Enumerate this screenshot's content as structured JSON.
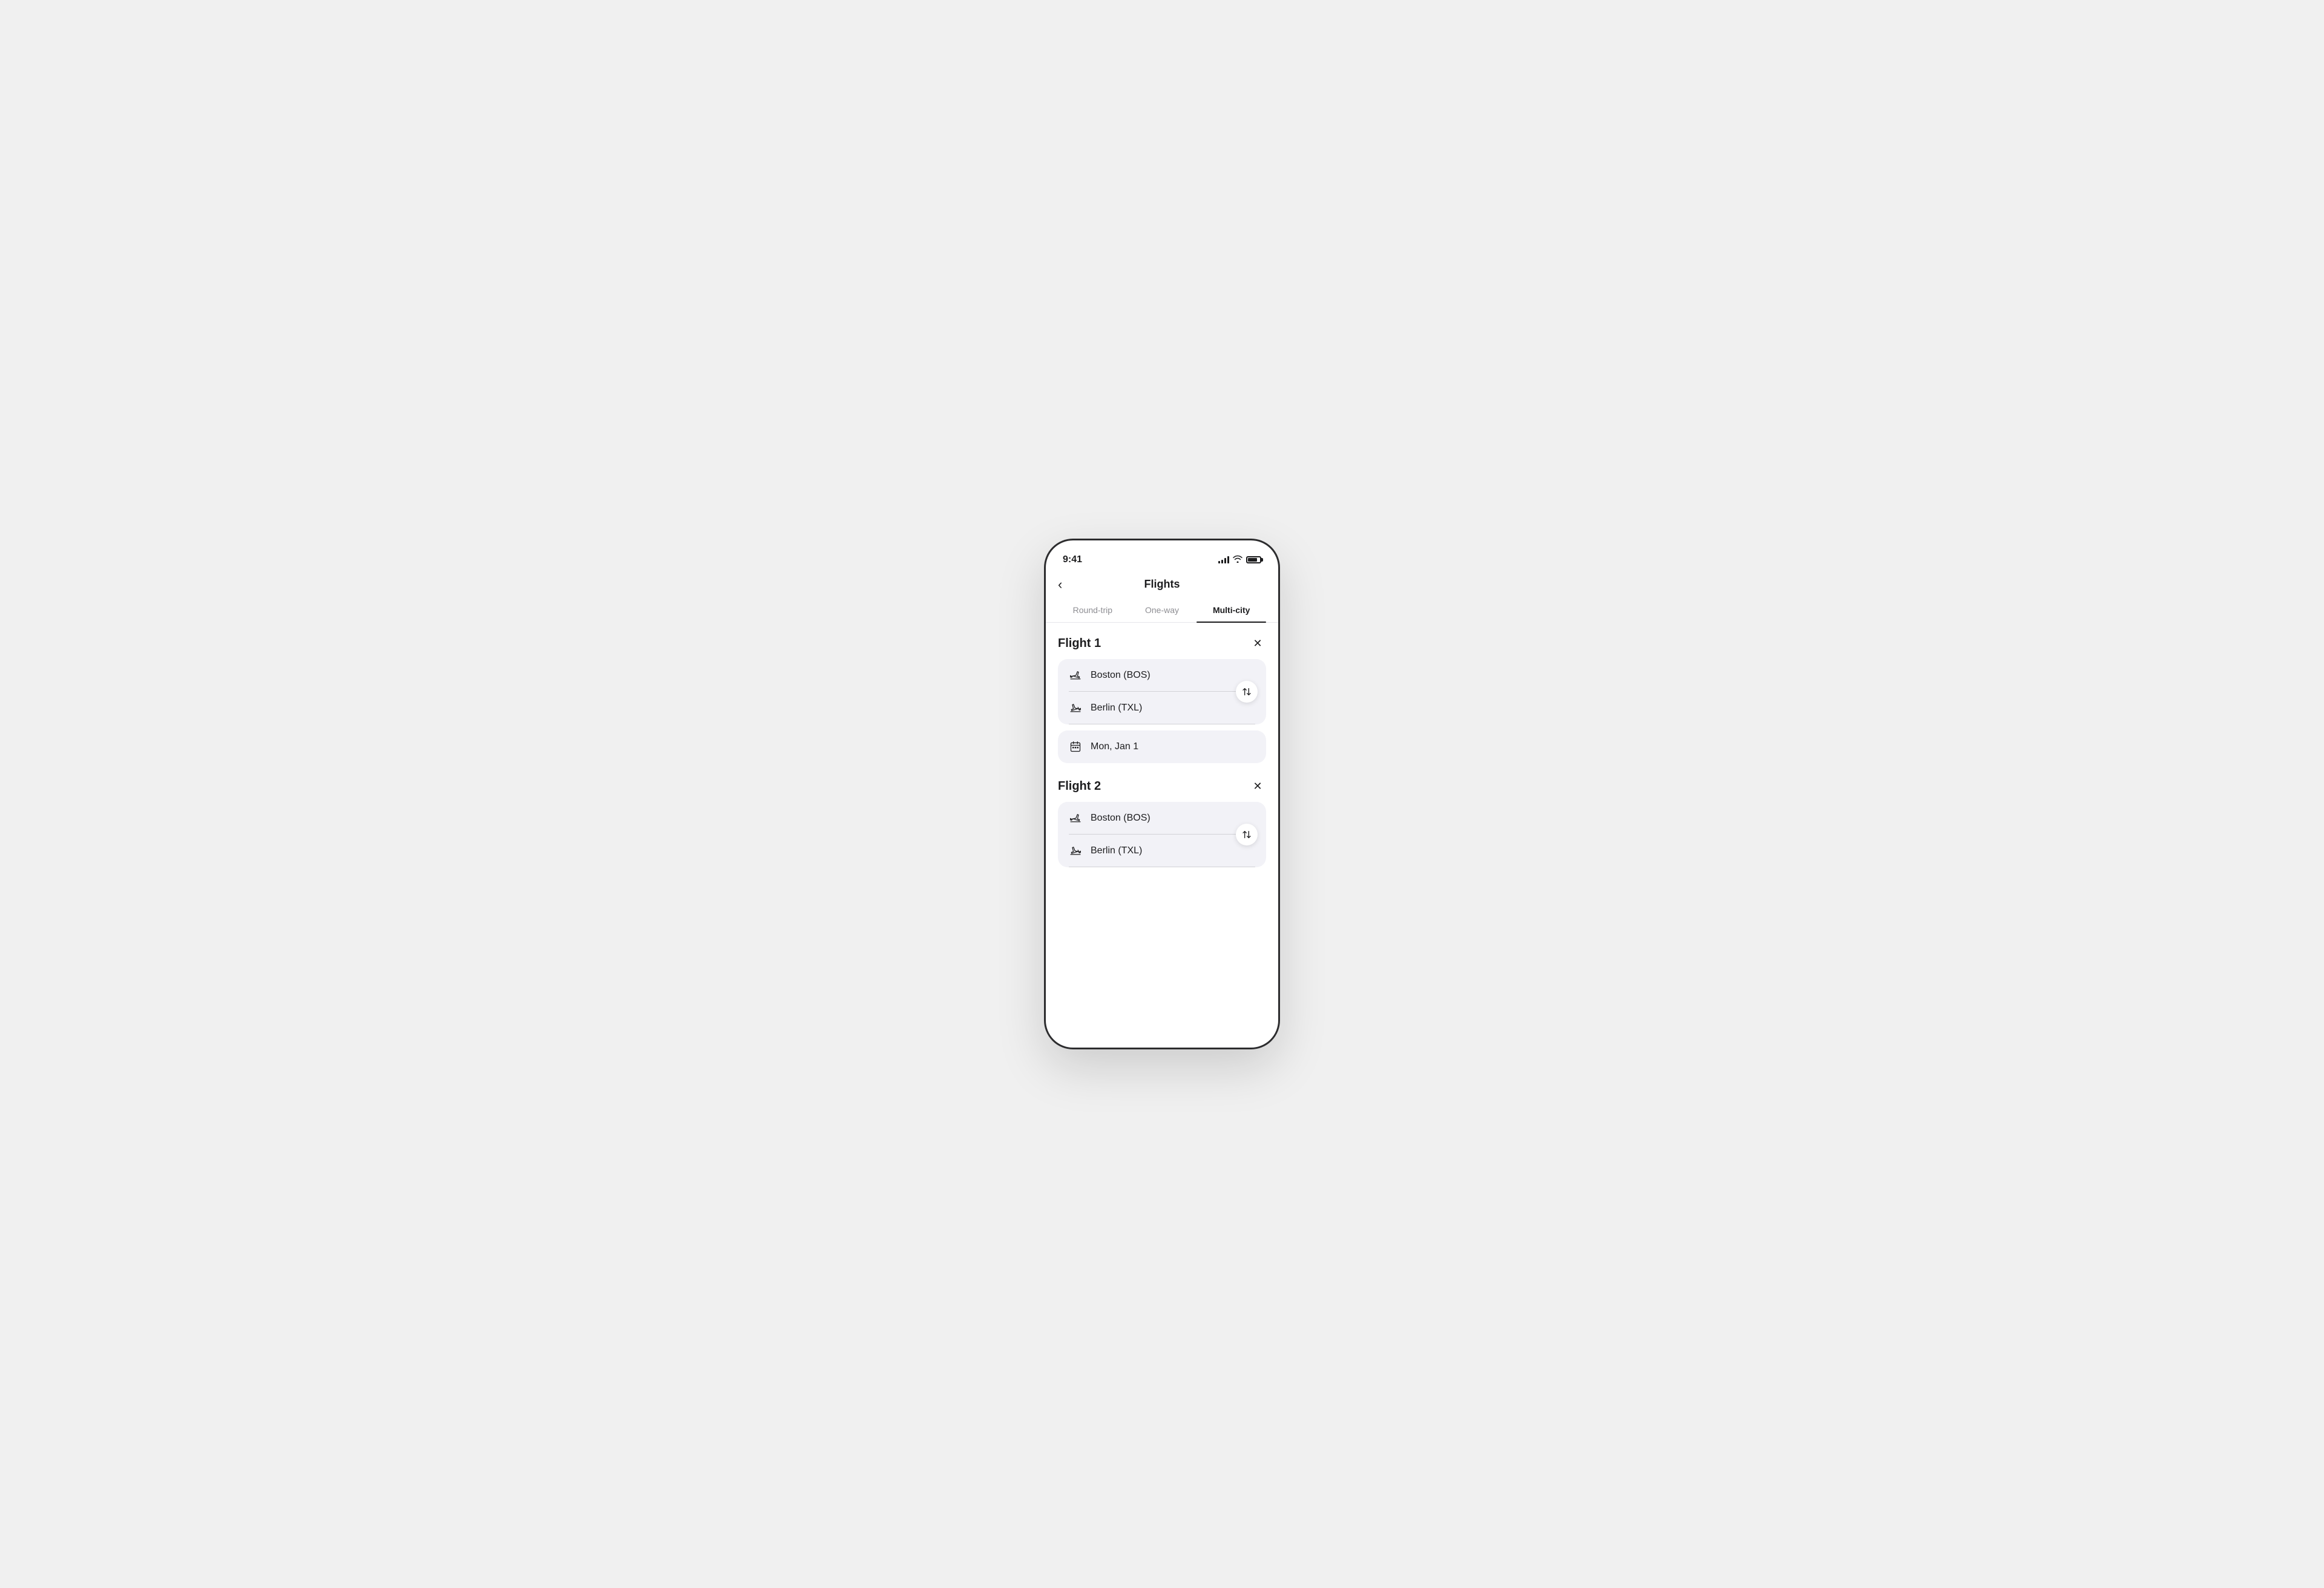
{
  "statusBar": {
    "time": "9:41",
    "signalBars": [
      4,
      6,
      8,
      10,
      12
    ],
    "wifi": "wifi",
    "battery": 80
  },
  "header": {
    "backLabel": "<",
    "title": "Flights"
  },
  "tabs": [
    {
      "id": "round-trip",
      "label": "Round-trip",
      "active": false
    },
    {
      "id": "one-way",
      "label": "One-way",
      "active": false
    },
    {
      "id": "multi-city",
      "label": "Multi-city",
      "active": true
    }
  ],
  "flights": [
    {
      "id": "flight-1",
      "label": "Flight 1",
      "from": "Boston (BOS)",
      "to": "Berlin (TXL)",
      "date": "Mon, Jan 1"
    },
    {
      "id": "flight-2",
      "label": "Flight 2",
      "from": "Boston (BOS)",
      "to": "Berlin (TXL)",
      "date": null
    }
  ],
  "icons": {
    "back": "‹",
    "close": "✕",
    "swap": "⇅",
    "planeDepart": "✈",
    "planeArrive": "✈",
    "calendar": "calendar"
  }
}
